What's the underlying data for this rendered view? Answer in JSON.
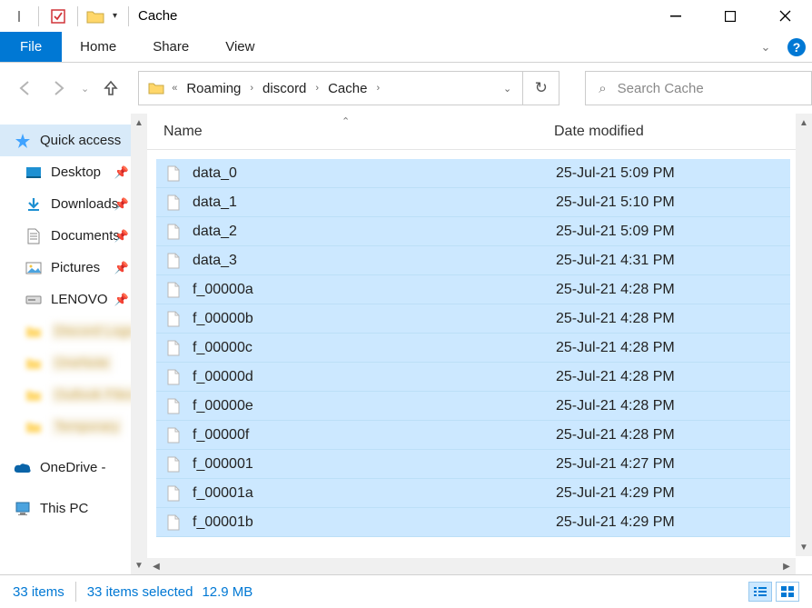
{
  "window": {
    "title": "Cache"
  },
  "menu": {
    "file": "File",
    "home": "Home",
    "share": "Share",
    "view": "View"
  },
  "breadcrumb": {
    "items": [
      "Roaming",
      "discord",
      "Cache"
    ]
  },
  "search": {
    "placeholder": "Search Cache"
  },
  "sidebar": {
    "quick": "Quick access",
    "desktop": "Desktop",
    "downloads": "Downloads",
    "documents": "Documents",
    "pictures": "Pictures",
    "lenovo": "LENOVO",
    "blur1": "Discord Logs",
    "blur2": "OneNote",
    "blur3": "Outlook Files",
    "blur4": "Temporary",
    "onedrive": "OneDrive -",
    "thispc": "This PC"
  },
  "columns": {
    "name": "Name",
    "date": "Date modified"
  },
  "files": [
    {
      "name": "data_0",
      "date": "25-Jul-21 5:09 PM"
    },
    {
      "name": "data_1",
      "date": "25-Jul-21 5:10 PM"
    },
    {
      "name": "data_2",
      "date": "25-Jul-21 5:09 PM"
    },
    {
      "name": "data_3",
      "date": "25-Jul-21 4:31 PM"
    },
    {
      "name": "f_00000a",
      "date": "25-Jul-21 4:28 PM"
    },
    {
      "name": "f_00000b",
      "date": "25-Jul-21 4:28 PM"
    },
    {
      "name": "f_00000c",
      "date": "25-Jul-21 4:28 PM"
    },
    {
      "name": "f_00000d",
      "date": "25-Jul-21 4:28 PM"
    },
    {
      "name": "f_00000e",
      "date": "25-Jul-21 4:28 PM"
    },
    {
      "name": "f_00000f",
      "date": "25-Jul-21 4:28 PM"
    },
    {
      "name": "f_000001",
      "date": "25-Jul-21 4:27 PM"
    },
    {
      "name": "f_00001a",
      "date": "25-Jul-21 4:29 PM"
    },
    {
      "name": "f_00001b",
      "date": "25-Jul-21 4:29 PM"
    }
  ],
  "status": {
    "count": "33 items",
    "selected": "33 items selected",
    "size": "12.9 MB"
  }
}
